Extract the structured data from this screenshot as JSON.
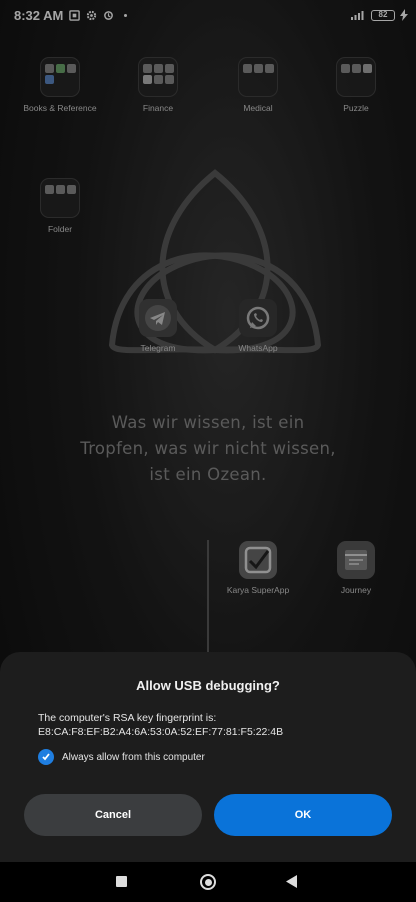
{
  "status_bar": {
    "time": "8:32 AM",
    "battery": "82"
  },
  "home": {
    "folders": [
      {
        "label": "Books & Reference"
      },
      {
        "label": "Finance"
      },
      {
        "label": "Medical"
      },
      {
        "label": "Puzzle"
      },
      {
        "label": "Folder"
      }
    ],
    "apps": [
      {
        "label": "Telegram",
        "icon": "telegram-icon"
      },
      {
        "label": "WhatsApp",
        "icon": "whatsapp-icon"
      },
      {
        "label": "Karya SuperApp",
        "icon": "karya-icon"
      },
      {
        "label": "Journey",
        "icon": "journey-icon"
      }
    ],
    "quote_lines": [
      "Was wir wissen, ist ein",
      "Tropfen, was wir nicht wissen,",
      "ist ein Ozean."
    ]
  },
  "dialog": {
    "title": "Allow USB debugging?",
    "message_line1": "The computer's RSA key fingerprint is:",
    "fingerprint": "E8:CA:F8:EF:B2:A4:6A:53:0A:52:EF:77:81:F5:22:4B",
    "checkbox_label": "Always allow from this computer",
    "checkbox_checked": true,
    "cancel_label": "Cancel",
    "ok_label": "OK",
    "accent": "#0a73d9"
  }
}
